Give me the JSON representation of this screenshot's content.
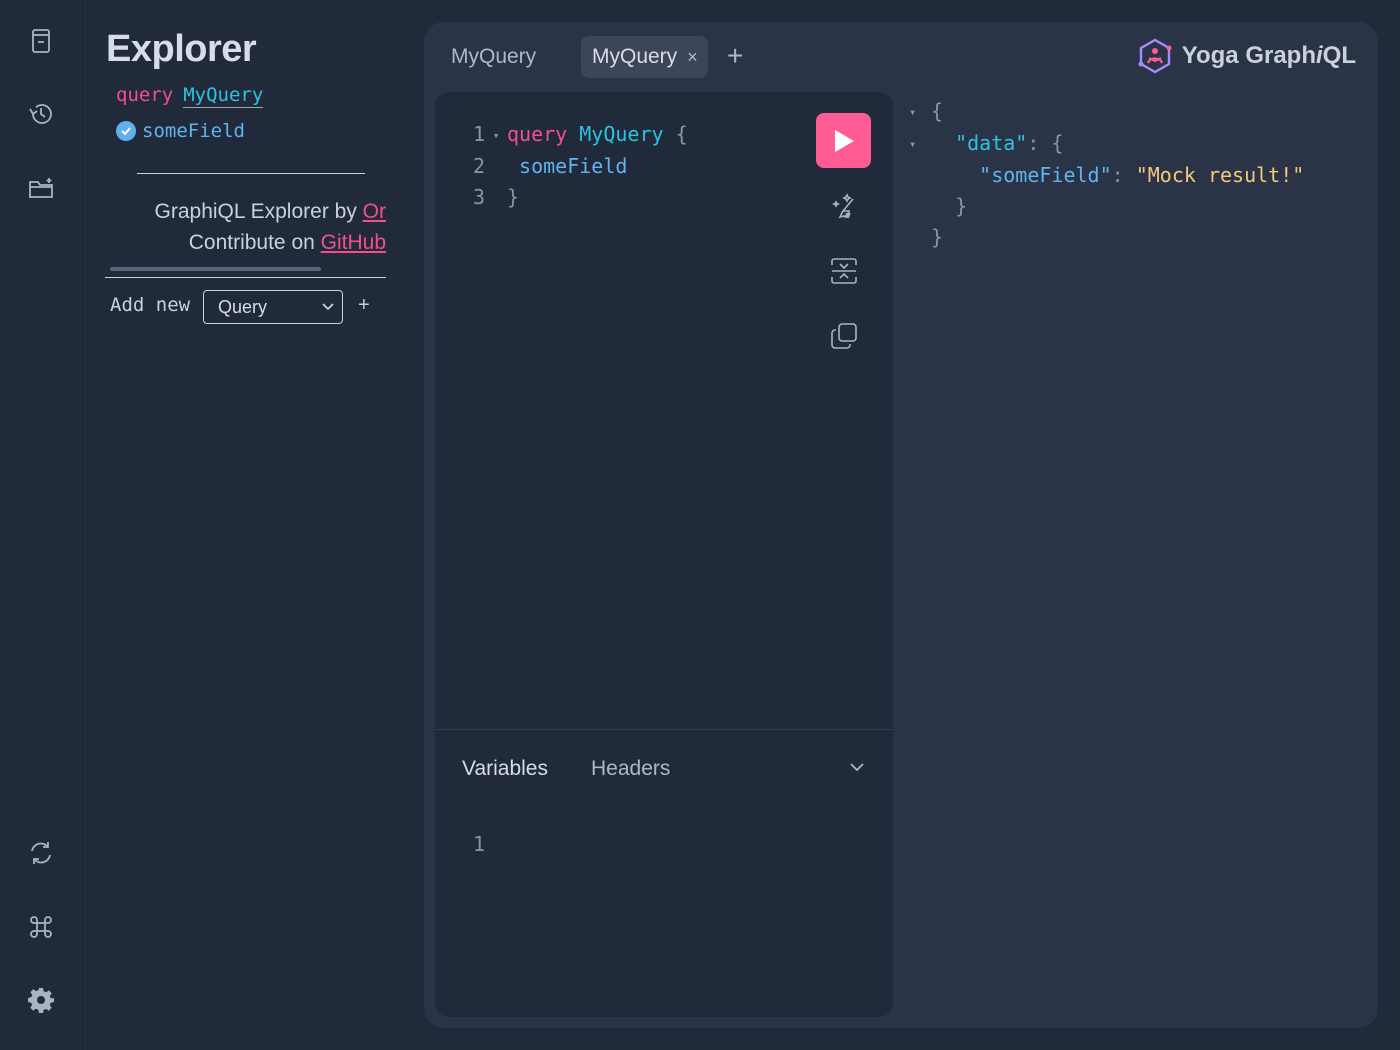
{
  "rail": {
    "top_icons": [
      "docs-icon",
      "history-icon",
      "add-folder-icon"
    ],
    "bottom_icons": [
      "refetch-schema-icon",
      "shortcuts-icon",
      "settings-icon"
    ]
  },
  "explorer": {
    "title": "Explorer",
    "operation_keyword": "query",
    "operation_name": "MyQuery",
    "field": "someField",
    "credit_prefix": "GraphiQL Explorer by ",
    "credit_link": "Or",
    "contribute_prefix": "Contribute on ",
    "contribute_link": "GitHub",
    "add_new_label": "Add new",
    "add_new_select": "Query",
    "add_new_plus": "+"
  },
  "tabs": [
    {
      "label": "MyQuery",
      "active": false
    },
    {
      "label": "MyQuery",
      "active": true,
      "close": "×"
    }
  ],
  "tab_add": "+",
  "brand": {
    "text_main": "Yoga Graph",
    "text_italic": "i",
    "text_end": "QL",
    "accent": "#ff5c95"
  },
  "editor": {
    "lines": [
      {
        "num": "1",
        "kw": "query",
        "name": "MyQuery",
        "brace": "{"
      },
      {
        "num": "2",
        "field": "someField"
      },
      {
        "num": "3",
        "brace": "}"
      }
    ],
    "fold_marker": "▾",
    "tabs": {
      "variables": "Variables",
      "headers": "Headers"
    },
    "variables_line": "1"
  },
  "result": {
    "open_brace": "{",
    "data_key": "\"data\"",
    "data_colon": ": {",
    "field_key": "\"someField\"",
    "field_colon": ": ",
    "field_value": "\"Mock result!\"",
    "inner_close": "}",
    "outer_close": "}"
  }
}
